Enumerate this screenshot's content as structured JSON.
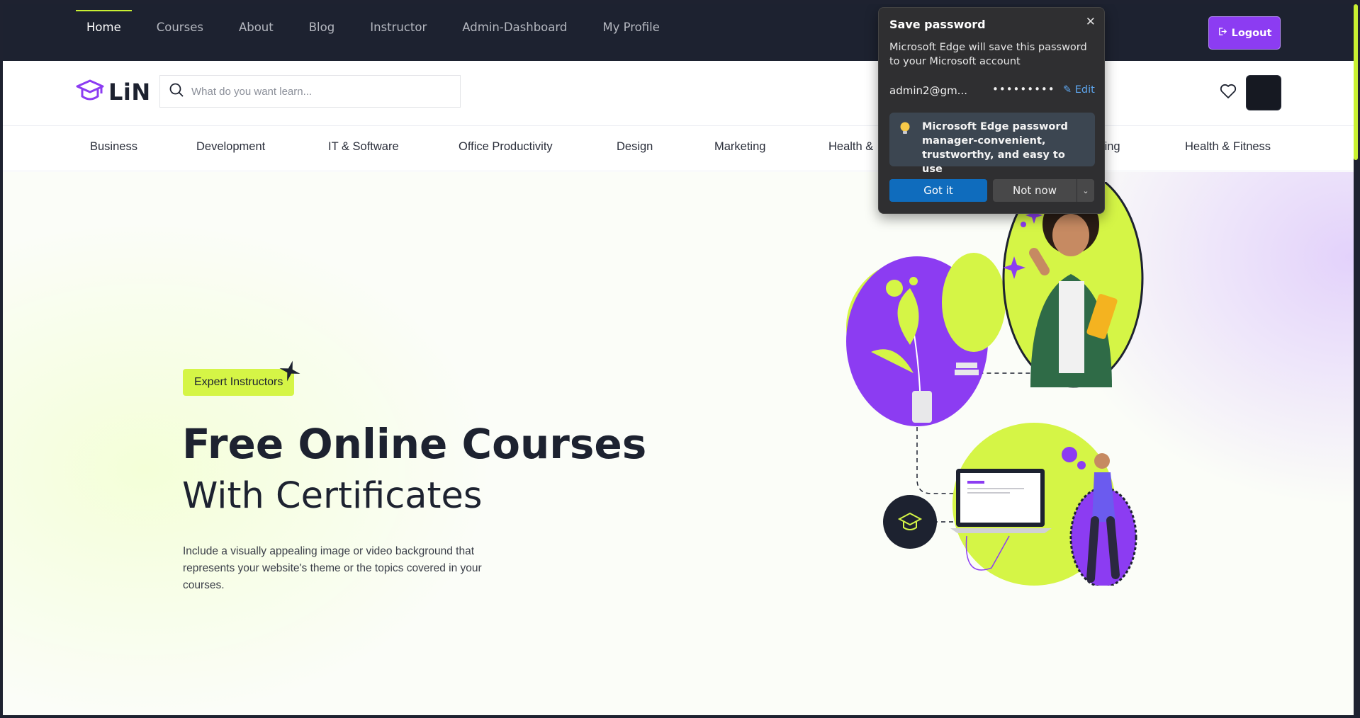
{
  "topnav": {
    "items": [
      "Home",
      "Courses",
      "About",
      "Blog",
      "Instructor",
      "Admin-Dashboard",
      "My Profile"
    ],
    "logout_label": "Logout"
  },
  "header": {
    "logo_text": "LiN",
    "search_placeholder": "What do you want learn..."
  },
  "categories": [
    "Business",
    "Development",
    "IT & Software",
    "Office Productivity",
    "Design",
    "Marketing",
    "Health &",
    "ting",
    "Health & Fitness"
  ],
  "hero": {
    "badge": "Expert Instructors",
    "title_line1": "Free Online Courses",
    "title_line2": "With Certificates",
    "description": "Include a visually appealing image or video background that represents your website's theme or the topics covered in your courses."
  },
  "password_popup": {
    "title": "Save password",
    "body": "Microsoft Edge will save this password to your Microsoft account",
    "username": "admin2@gm...",
    "password": "•••••••••",
    "edit_label": "Edit",
    "tip": "Microsoft Edge password manager-convenient, trustworthy, and easy to use",
    "got_it_label": "Got it",
    "not_now_label": "Not now"
  },
  "colors": {
    "accent_lime": "#d5f546",
    "accent_purple": "#8c3cf2",
    "dark": "#1d2230",
    "edge_blue": "#0f6cbd"
  }
}
